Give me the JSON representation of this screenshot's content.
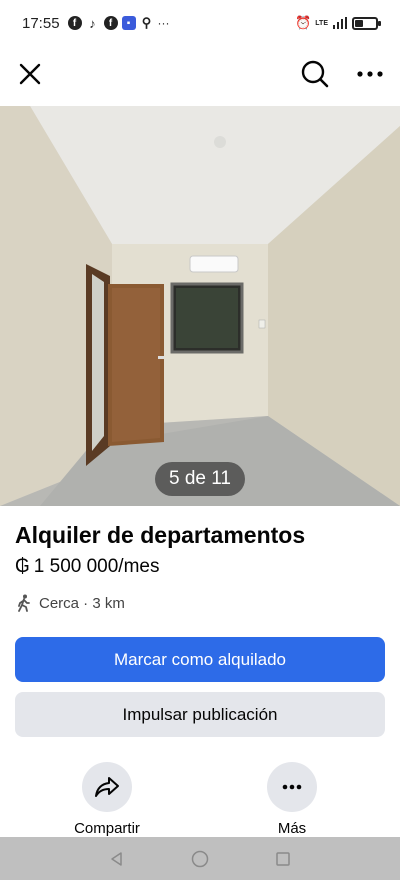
{
  "status_bar": {
    "time": "17:55",
    "dots": "···",
    "network": "LTE",
    "battery_level": 0.35
  },
  "photo": {
    "counter": "5 de 11"
  },
  "listing": {
    "title": "Alquiler de departamentos",
    "currency_symbol": "₲",
    "price": "1 500 000/mes",
    "distance": "Cerca · 3 km"
  },
  "buttons": {
    "mark_rented": "Marcar como alquilado",
    "boost": "Impulsar publicación"
  },
  "actions": {
    "share_label": "Compartir",
    "more_label": "Más"
  },
  "colors": {
    "primary": "#2d6be8",
    "secondary_bg": "#e4e6eb",
    "nav_bar": "#bfbfbf"
  }
}
